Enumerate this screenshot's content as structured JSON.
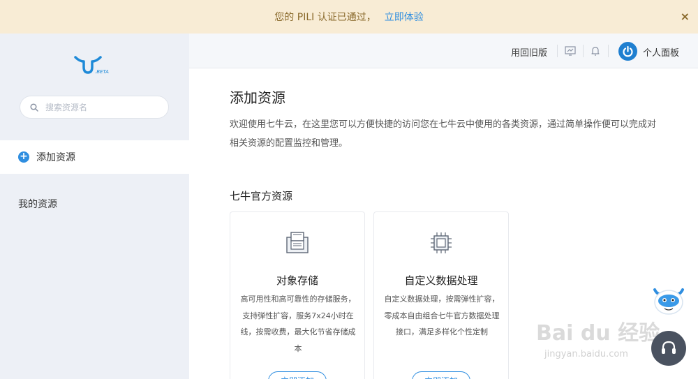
{
  "banner": {
    "message": "您的 PILI 认证已通过，",
    "link": "立即体验",
    "close": "×"
  },
  "sidebar": {
    "logo_badge": ".BETA",
    "search_placeholder": "搜索资源名",
    "items": [
      {
        "label": "添加资源",
        "icon": "plus-circle-icon",
        "active": true
      },
      {
        "label": "我的资源",
        "active": false
      }
    ]
  },
  "topbar": {
    "old_version": "用回旧版",
    "panel_label": "个人面板"
  },
  "main": {
    "title": "添加资源",
    "intro": "欢迎使用七牛云，在这里您可以方便快捷的访问您在七牛云中使用的各类资源，通过简单操作便可以完成对相关资源的配置监控和管理。",
    "section_title": "七牛官方资源",
    "cards": [
      {
        "title": "对象存储",
        "desc": "高可用性和高可靠性的存储服务，支持弹性扩容，服务7x24小时在线，按需收费，最大化节省存储成本",
        "button": "立即添加",
        "icon": "storage-icon"
      },
      {
        "title": "自定义数据处理",
        "desc": "自定义数据处理，按需弹性扩容，零成本自由组合七牛官方数据处理接口，满足多样化个性定制",
        "button": "立即添加",
        "icon": "chip-icon"
      }
    ]
  },
  "watermark": {
    "text": "Bai du 经验",
    "sub": "jingyan.baidu.com"
  },
  "colors": {
    "accent": "#2f8ee0",
    "banner_bg": "#f8ecd5",
    "sidebar_bg": "#edf0f6"
  }
}
